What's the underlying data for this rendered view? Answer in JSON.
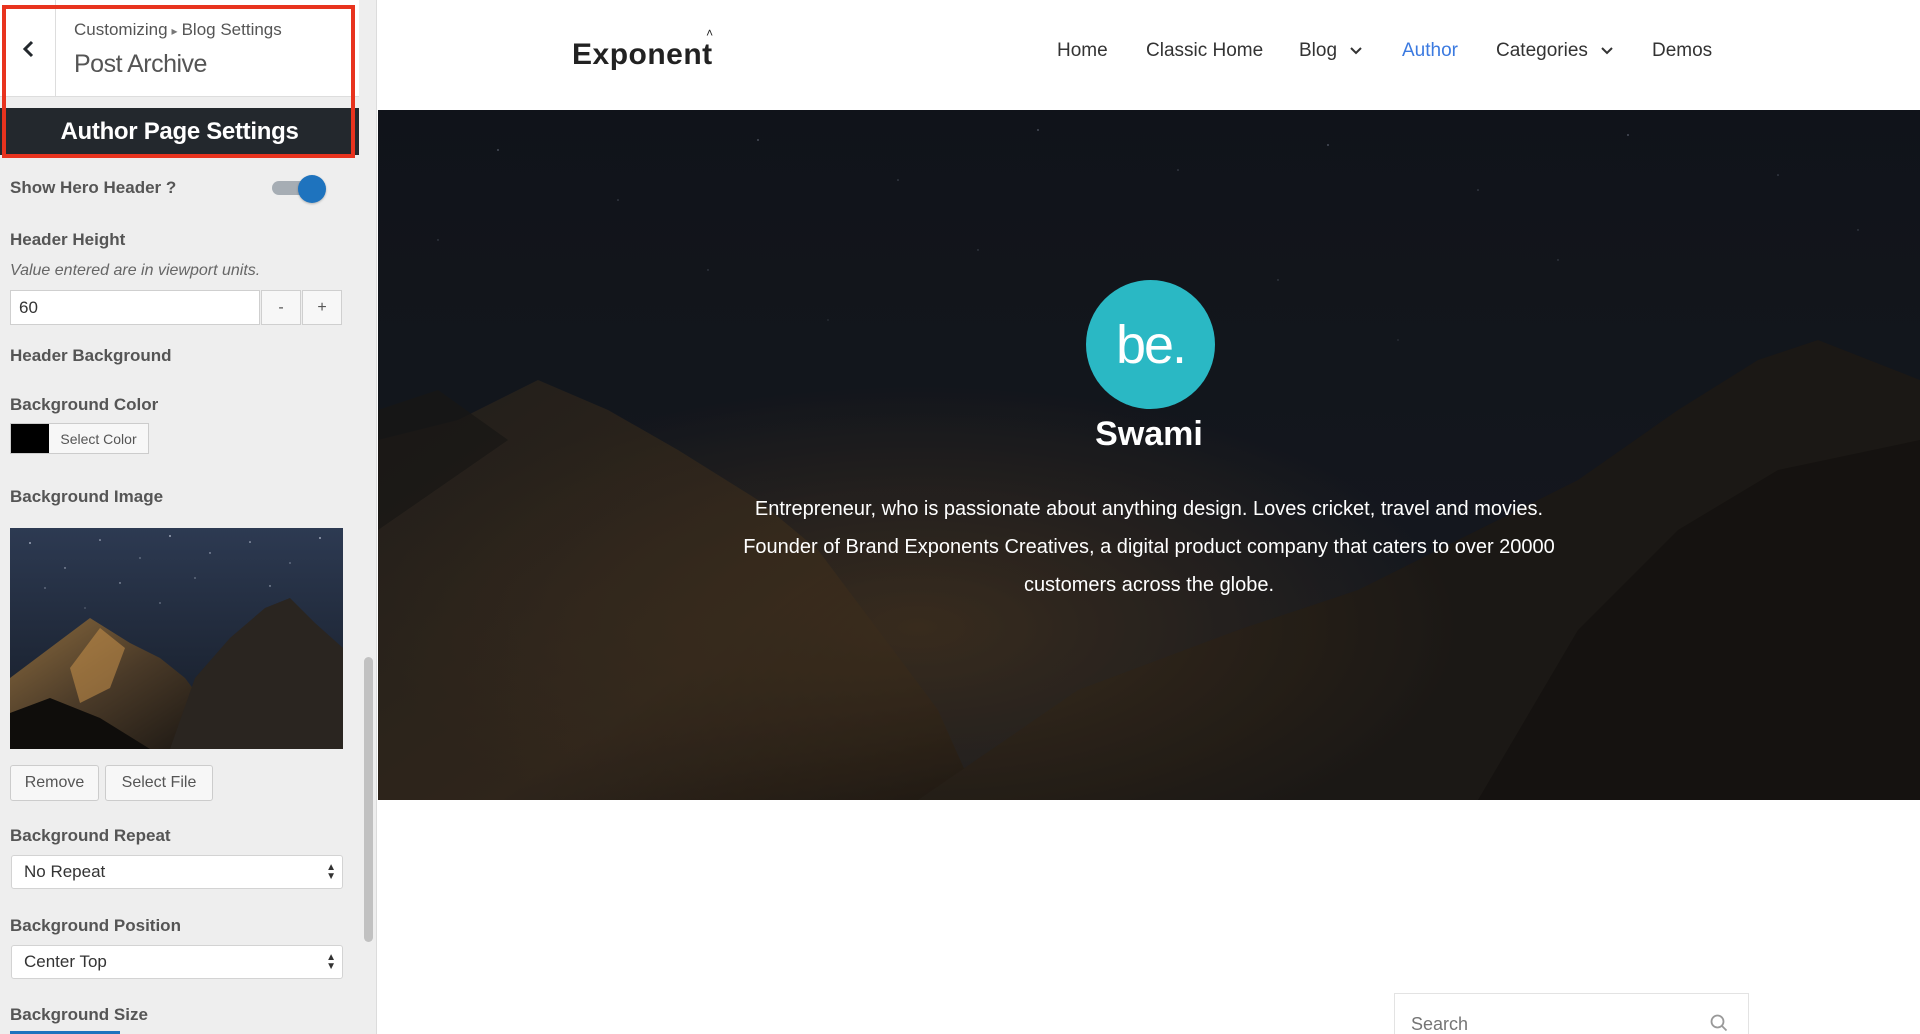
{
  "customizer": {
    "breadcrumb_root": "Customizing",
    "breadcrumb_separator": "▸",
    "breadcrumb_parent": "Blog Settings",
    "section_title": "Post Archive",
    "panel_title": "Author Page Settings",
    "highlight_color": "#e8331e",
    "controls": {
      "show_hero_header": {
        "label": "Show Hero Header ?",
        "enabled": true
      },
      "header_height": {
        "label": "Header Height",
        "description": "Value entered are in viewport units.",
        "value": "60",
        "decrement_label": "-",
        "increment_label": "+"
      },
      "header_background": {
        "label": "Header Background"
      },
      "background_color": {
        "label": "Background Color",
        "value": "#000000",
        "button_label": "Select Color"
      },
      "background_image": {
        "label": "Background Image",
        "remove_label": "Remove",
        "select_label": "Select File"
      },
      "background_repeat": {
        "label": "Background Repeat",
        "value": "No Repeat"
      },
      "background_position": {
        "label": "Background Position",
        "value": "Center Top"
      },
      "background_size": {
        "label": "Background Size"
      }
    }
  },
  "site": {
    "logo": "Exponent",
    "logo_mark": "˄",
    "nav": {
      "home": "Home",
      "classic_home": "Classic Home",
      "blog": "Blog",
      "author": "Author",
      "categories": "Categories",
      "demos": "Demos"
    },
    "active_nav": "Author",
    "accent_color": "#3b7ae0",
    "hero": {
      "avatar_text": "be.",
      "avatar_color": "#2ab8c4",
      "author_name": "Swami",
      "bio_line1": "Entrepreneur, who is passionate about anything design. Loves cricket, travel and movies.",
      "bio_line2": "Founder of Brand Exponents Creatives, a digital product company that caters to over 20000",
      "bio_line3": "customers across the globe."
    },
    "search": {
      "placeholder": "Search",
      "icon": "search-icon"
    }
  }
}
